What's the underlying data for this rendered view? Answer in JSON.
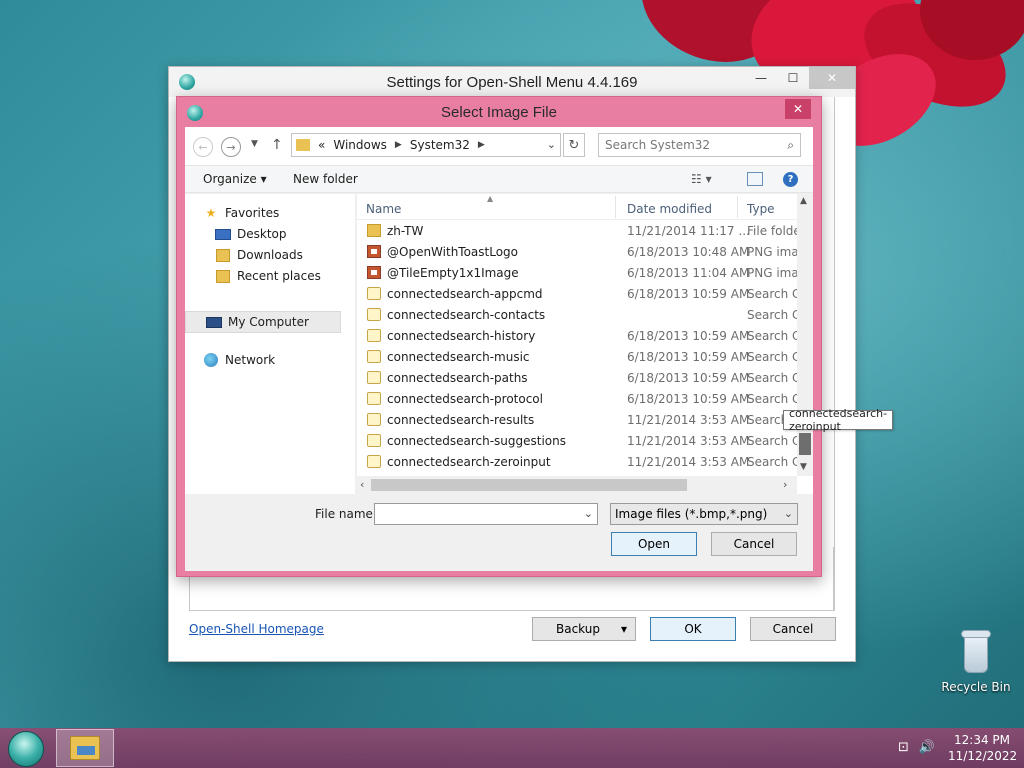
{
  "settings_window": {
    "title": "Settings for Open-Shell Menu 4.4.169",
    "homepage_link": "Open-Shell Homepage",
    "backup_label": "Backup",
    "ok_label": "OK",
    "cancel_label": "Cancel"
  },
  "dialog": {
    "title": "Select Image File",
    "address": {
      "prefix": "«",
      "parts": [
        "Windows",
        "System32"
      ]
    },
    "search_placeholder": "Search System32",
    "toolbar": {
      "organize": "Organize",
      "new_folder": "New folder"
    },
    "nav": {
      "favorites": "Favorites",
      "desktop": "Desktop",
      "downloads": "Downloads",
      "recent_places": "Recent places",
      "my_computer": "My Computer",
      "network": "Network"
    },
    "columns": {
      "name": "Name",
      "date": "Date modified",
      "type": "Type"
    },
    "files": [
      {
        "name": "zh-TW",
        "date": "11/21/2014 11:17 ...",
        "type": "File folder",
        "icon": "folder"
      },
      {
        "name": "@OpenWithToastLogo",
        "date": "6/18/2013 10:48 AM",
        "type": "PNG image",
        "icon": "png"
      },
      {
        "name": "@TileEmpty1x1Image",
        "date": "6/18/2013 11:04 AM",
        "type": "PNG image",
        "icon": "png"
      },
      {
        "name": "connectedsearch-appcmd",
        "date": "6/18/2013 10:59 AM",
        "type": "Search Connector",
        "icon": "search-connector"
      },
      {
        "name": "connectedsearch-contacts",
        "date": "",
        "type": "Search Connector",
        "icon": "search-connector"
      },
      {
        "name": "connectedsearch-history",
        "date": "6/18/2013 10:59 AM",
        "type": "Search Connector",
        "icon": "search-connector"
      },
      {
        "name": "connectedsearch-music",
        "date": "6/18/2013 10:59 AM",
        "type": "Search Connector",
        "icon": "search-connector"
      },
      {
        "name": "connectedsearch-paths",
        "date": "6/18/2013 10:59 AM",
        "type": "Search Connector",
        "icon": "search-connector"
      },
      {
        "name": "connectedsearch-protocol",
        "date": "6/18/2013 10:59 AM",
        "type": "Search Connector",
        "icon": "search-connector"
      },
      {
        "name": "connectedsearch-results",
        "date": "11/21/2014 3:53 AM",
        "type": "Search Connector",
        "icon": "search-connector"
      },
      {
        "name": "connectedsearch-suggestions",
        "date": "11/21/2014 3:53 AM",
        "type": "Search Connector",
        "icon": "search-connector"
      },
      {
        "name": "connectedsearch-zeroinput",
        "date": "11/21/2014 3:53 AM",
        "type": "Search Connector",
        "icon": "search-connector"
      }
    ],
    "tooltip": "connectedsearch-zeroinput",
    "file_name_label": "File name:",
    "file_name_value": "",
    "filter_value": "Image files (*.bmp,*.png)",
    "open_label": "Open",
    "cancel_label": "Cancel"
  },
  "desktop": {
    "recycle_bin": "Recycle Bin"
  },
  "taskbar": {
    "time": "12:34 PM",
    "date": "11/12/2022"
  },
  "colors": {
    "dialog_frame": "#e97ea3",
    "link": "#1a55b4",
    "taskbar": "#8a4a72"
  }
}
